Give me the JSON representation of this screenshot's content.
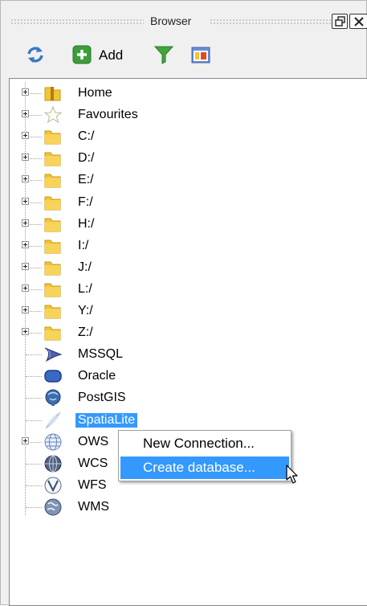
{
  "panel": {
    "title": "Browser"
  },
  "toolbar": {
    "refresh_icon": "refresh-icon",
    "add_label": "Add",
    "filter_icon": "filter-icon",
    "collapse_icon": "collapse-all-icon"
  },
  "tree": {
    "items": [
      {
        "label": "Home",
        "icon": "home-folder-icon",
        "expandable": true
      },
      {
        "label": "Favourites",
        "icon": "star-icon",
        "expandable": true
      },
      {
        "label": "C:/",
        "icon": "folder-icon",
        "expandable": true
      },
      {
        "label": "D:/",
        "icon": "folder-icon",
        "expandable": true
      },
      {
        "label": "E:/",
        "icon": "folder-icon",
        "expandable": true
      },
      {
        "label": "F:/",
        "icon": "folder-icon",
        "expandable": true
      },
      {
        "label": "H:/",
        "icon": "folder-icon",
        "expandable": true
      },
      {
        "label": "I:/",
        "icon": "folder-icon",
        "expandable": true
      },
      {
        "label": "J:/",
        "icon": "folder-icon",
        "expandable": true
      },
      {
        "label": "L:/",
        "icon": "folder-icon",
        "expandable": true
      },
      {
        "label": "Y:/",
        "icon": "folder-icon",
        "expandable": true
      },
      {
        "label": "Z:/",
        "icon": "folder-icon",
        "expandable": true
      },
      {
        "label": "MSSQL",
        "icon": "mssql-icon",
        "expandable": false
      },
      {
        "label": "Oracle",
        "icon": "oracle-icon",
        "expandable": false
      },
      {
        "label": "PostGIS",
        "icon": "postgis-icon",
        "expandable": false
      },
      {
        "label": "SpatiaLite",
        "icon": "spatialite-feather-icon",
        "expandable": false,
        "selected": true
      },
      {
        "label": "OWS",
        "icon": "ows-globe-icon",
        "expandable": true
      },
      {
        "label": "WCS",
        "icon": "wcs-globe-icon",
        "expandable": false
      },
      {
        "label": "WFS",
        "icon": "wfs-globe-icon",
        "expandable": false
      },
      {
        "label": "WMS",
        "icon": "wms-globe-icon",
        "expandable": false
      }
    ]
  },
  "context_menu": {
    "items": [
      {
        "label": "New Connection..."
      },
      {
        "label": "Create database...",
        "highlighted": true
      }
    ]
  },
  "colors": {
    "selection": "#3399ff",
    "panel_bg": "#f0f0f0",
    "folder": "#f2c432"
  }
}
